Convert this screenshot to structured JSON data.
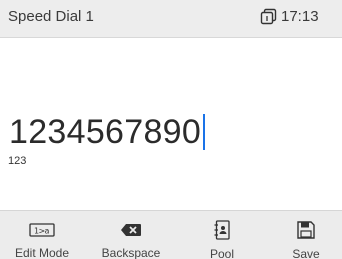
{
  "header": {
    "title": "Speed Dial 1",
    "status_icon": "copy-icon",
    "time": "17:13"
  },
  "entry": {
    "value": "1234567890",
    "input_mode": "123"
  },
  "softkeys": [
    {
      "label": "Edit Mode",
      "icon": "edit-mode-icon"
    },
    {
      "label": "Backspace",
      "icon": "backspace-icon"
    },
    {
      "label": "Pool",
      "icon": "contacts-book-icon"
    },
    {
      "label": "Save",
      "icon": "save-icon"
    }
  ],
  "colors": {
    "caret": "#1a73e8",
    "header_bg": "#ededed",
    "softkey_bg": "#ececec"
  }
}
